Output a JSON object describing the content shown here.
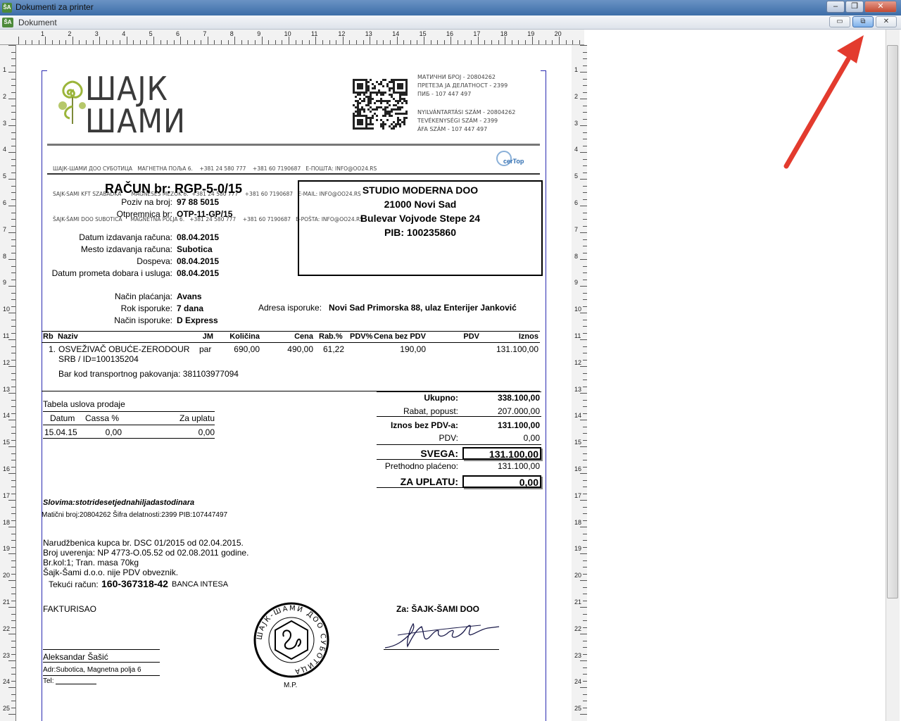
{
  "window": {
    "title": "Dokumenti za printer",
    "doc_title": "Dokument"
  },
  "colors": {
    "titlebar": "#3d6da8",
    "arrow": "#e33b2e",
    "border_blue": "#2a2ab0"
  },
  "header": {
    "logo_line1": "ШАЈК",
    "logo_line2": "ШАМИ",
    "company_block_right_1": [
      "МАТИЧНИ БРОЈ - 20804262",
      "ПРЕТЕЗА ЈА ДЕЛАТНОСТ - 2399",
      "ПИБ - 107 447 497"
    ],
    "company_block_right_2": [
      "NYILVÁNTARTÁSI SZÁM - 20804262",
      "TEVÉKENYSÉGI SZÁM - 2399",
      "ÁFA SZÁM - 107 447 497"
    ],
    "address_lines": [
      "ШАЈК-ШАМИ ДОО СУБОТИЦА   МАГНЕТНА ПОЉА 6.    +381 24 580 777    +381 60 7190687   Е-ПОШТА: INFO@OO24.RS",
      "SAJK-SAMI KFT SZABADKA      MÁGNESES MEZŐK 6.  +381 24 580 777    +381 60 7190687   E-MAIL: INFO@OO24.RS",
      "ŠAJK-ŠAMI DOO SUBOTICA     MAGNETNA POLJA 6.   +381 24 580 777    +381 60 7190687   E-POŠTA: INFO@OO24.RS"
    ],
    "cert_label": "cerTop"
  },
  "invoice": {
    "title": "RAČUN br: RGP-5-0/15",
    "fields": [
      {
        "label": "Poziv na broj:",
        "value": "97 88  5015"
      },
      {
        "label": "Otpremnica br:",
        "value": "OTP-11-GP/15"
      }
    ],
    "dates": [
      {
        "label": "Datum izdavanja računa:",
        "value": "08.04.2015"
      },
      {
        "label": "Mesto izdavanja računa:",
        "value": "Subotica"
      },
      {
        "label": "Dospeva:",
        "value": "08.04.2015"
      },
      {
        "label": "Datum prometa dobara i usluga:",
        "value": "08.04.2015"
      }
    ],
    "payment": [
      {
        "label": "Način plaćanja:",
        "value": "Avans"
      },
      {
        "label": "Rok isporuke:",
        "value": "7 dana"
      },
      {
        "label": "Način isporuke:",
        "value": "D Express"
      }
    ],
    "delivery_label": "Adresa isporuke:",
    "delivery_value": "Novi Sad  Primorska 88, ulaz Enterijer Janković"
  },
  "buyer": {
    "lines": [
      "STUDIO MODERNA DOO",
      "21000 Novi Sad",
      "Bulevar Vojvode Stepe 24",
      "PIB: 100235860"
    ]
  },
  "table": {
    "headers": [
      "Rb",
      "Naziv",
      "JM",
      "Količina",
      "Cena",
      "Rab.%",
      "PDV%",
      "Cena bez PDV",
      "PDV",
      "Iznos"
    ],
    "row": {
      "rb": "1.",
      "naziv": "OSVEŽIVAČ OBUĆE-ZERODOUR",
      "naziv2": "SRB / ID=100135204",
      "jm": "par",
      "kolicina": "690,00",
      "cena": "490,00",
      "rabat": "61,22",
      "pdv_pct": "",
      "cena_bez": "190,00",
      "pdv": "",
      "iznos": "131.100,00"
    },
    "barcode": "Bar kod transportnog pakovanja: 381103977094"
  },
  "terms": {
    "title": "Tabela uslova prodaje",
    "h_datum": "Datum",
    "h_cassa": "Cassa %",
    "h_za": "Za uplatu",
    "datum": "15.04.15",
    "cassa": "0,00",
    "za": "0,00"
  },
  "totals": [
    {
      "label": "Ukupno:",
      "value": "338.100,00"
    },
    {
      "label": "Rabat, popust:",
      "value": "207.000,00"
    },
    {
      "label": "Iznos bez PDV-a:",
      "value": "131.100,00"
    },
    {
      "label": "PDV:",
      "value": "0,00"
    },
    {
      "label": "SVEGA:",
      "value": "131.100,00"
    },
    {
      "label": "Prethodno plaćeno:",
      "value": "131.100,00"
    },
    {
      "label": "ZA UPLATU:",
      "value": "0,00"
    }
  ],
  "footer": {
    "slovima": "Slovima:stotridesetjednahiljadastodinara",
    "maticni": "Matični broj:20804262 Šifra delatnosti:2399 PIB:107447497",
    "notes": [
      "Narudžbenica kupca br. DSC 01/2015 od 02.04.2015.",
      "Broj uverenja: NP 4773-O.05.52 od 02.08.2011 godine.",
      "Br.kol:1; Tran. masa 70kg",
      "Šajk-Šami d.o.o. nije PDV obveznik."
    ],
    "tekuci_label": "Tekući račun:",
    "tekuci_value": "160-367318-42",
    "banka": "BANCA INTESA",
    "fakturisao": "FAKTURISAO",
    "za": "Za: ŠAJK-ŠAMI DOO",
    "person": "Aleksandar Šašić",
    "adr": "Adr:Subotica, Magnetna polja 6",
    "tel": "Tel:",
    "mp": "M.P.",
    "stamp_text": "ШАЈК-ШАМИ ДОО СУБОТИЦА"
  },
  "ruler": {
    "h": [
      "1",
      "2",
      "3",
      "4",
      "5",
      "6",
      "7",
      "8",
      "9",
      "10",
      "11",
      "12",
      "13",
      "14",
      "15",
      "16",
      "17",
      "18",
      "19",
      "20"
    ],
    "v": [
      "1",
      "2",
      "3",
      "4",
      "5",
      "6",
      "7",
      "8",
      "9",
      "10",
      "11",
      "12",
      "13",
      "14",
      "15",
      "16",
      "17",
      "18",
      "19",
      "20",
      "21",
      "22",
      "23",
      "24",
      "25"
    ]
  }
}
